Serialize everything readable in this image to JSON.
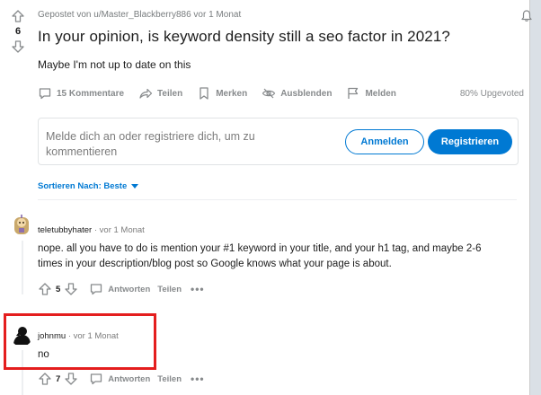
{
  "post": {
    "vote_count": "6",
    "meta": "Gepostet von u/Master_Blackberry886 vor 1 Monat",
    "title": "In your opinion, is keyword density still a seo factor in 2021?",
    "body": "Maybe I'm not up to date on this",
    "actions": {
      "comments": "15 Kommentare",
      "share": "Teilen",
      "save": "Merken",
      "hide": "Ausblenden",
      "report": "Melden"
    },
    "upvoted": "80% Upgevoted"
  },
  "login": {
    "prompt": "Melde dich an oder registriere dich, um zu kommentieren",
    "login_label": "Anmelden",
    "register_label": "Registrieren"
  },
  "sort": {
    "label": "Sortieren Nach: Beste"
  },
  "comments": [
    {
      "user": "teletubbyhater",
      "time": "· vor 1 Monat",
      "text": "nope. all you have to do is mention your #1 keyword in your title, and your h1 tag, and maybe 2-6 times in your description/blog post so Google knows what your page is about.",
      "score": "5",
      "reply_label": "Antworten",
      "share_label": "Teilen",
      "more": "•••"
    },
    {
      "user": "johnmu",
      "time": "· vor 1 Monat",
      "text": "no",
      "score": "7",
      "reply_label": "Antworten",
      "share_label": "Teilen",
      "more": "•••"
    }
  ],
  "colors": {
    "accent": "#0079d3",
    "highlight": "#e41e1e",
    "background": "#dae0e6"
  }
}
